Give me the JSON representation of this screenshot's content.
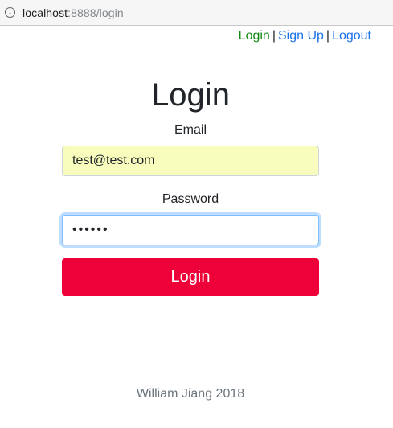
{
  "browser": {
    "url_host": "localhost",
    "url_rest": ":8888/login",
    "info_icon_glyph": "i"
  },
  "nav": {
    "login": "Login",
    "separator": "|",
    "signup": "Sign Up",
    "logout": "Logout",
    "login_color": "#138a13",
    "link_color": "#1a73e8"
  },
  "form": {
    "title": "Login",
    "email_label": "Email",
    "email_value": "test@test.com",
    "password_label": "Password",
    "password_value": "••••••",
    "submit_label": "Login",
    "submit_color": "#ee0038"
  },
  "footer": {
    "text": "William Jiang 2018"
  }
}
